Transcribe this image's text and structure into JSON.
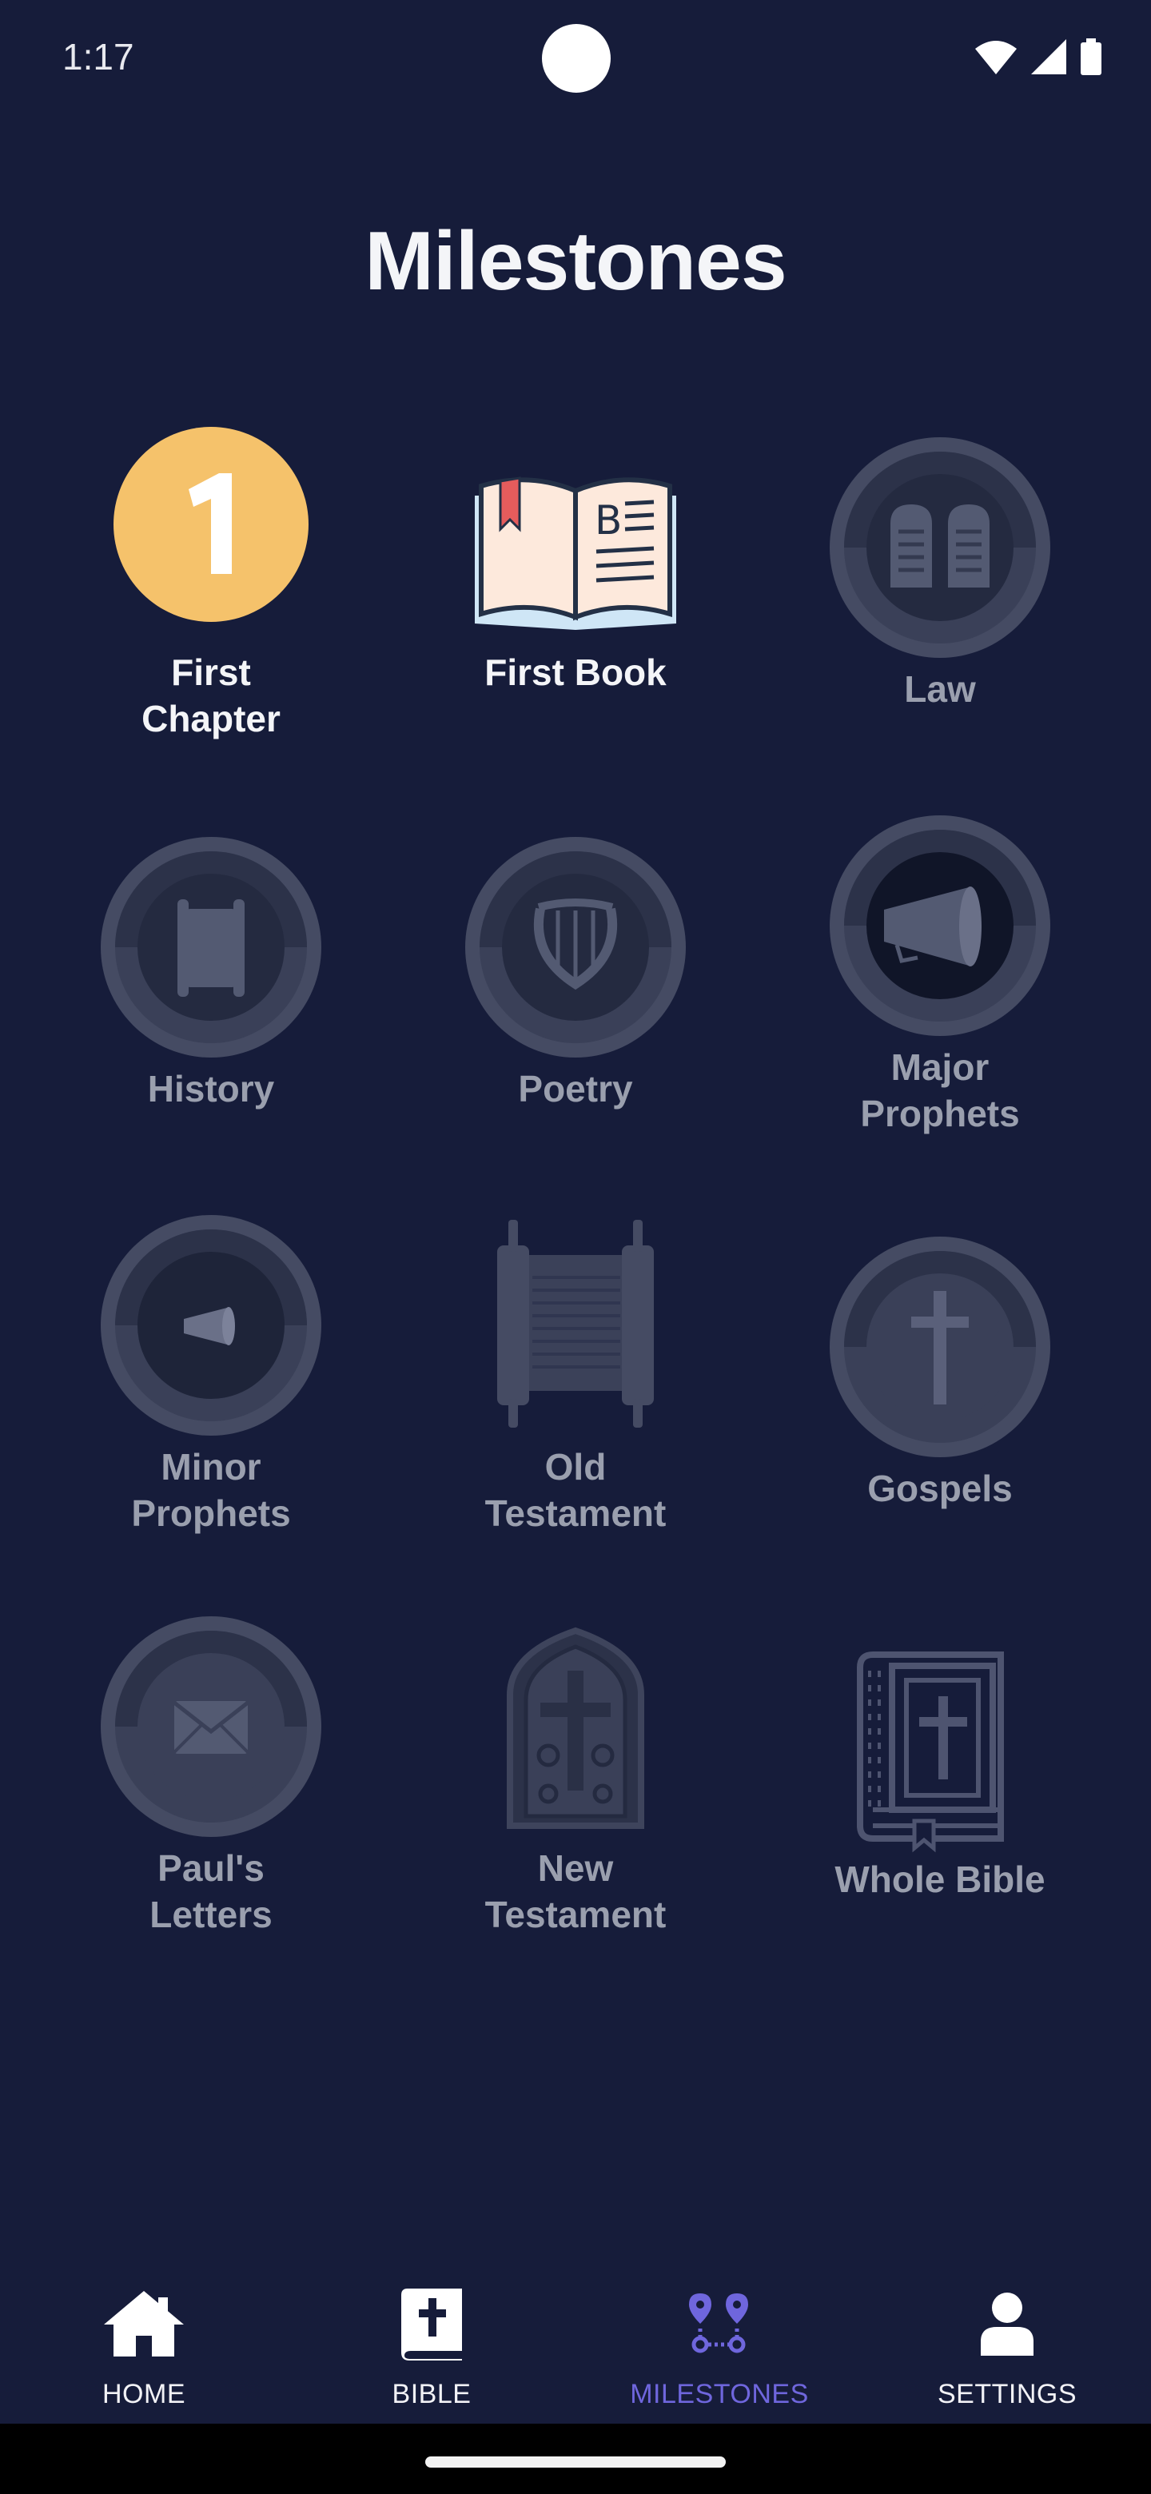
{
  "status_bar": {
    "time": "1:17",
    "icons": [
      "wifi-icon",
      "cell-signal-icon",
      "battery-icon"
    ]
  },
  "page": {
    "title": "Milestones"
  },
  "milestones": [
    {
      "label": "First\nChapter",
      "icon": "number-one-badge",
      "achieved": true
    },
    {
      "label": "First Book",
      "icon": "open-book-icon",
      "achieved": true
    },
    {
      "label": "Law",
      "icon": "stone-tablets-icon",
      "achieved": false
    },
    {
      "label": "History",
      "icon": "scroll-icon",
      "achieved": false
    },
    {
      "label": "Poetry",
      "icon": "lyre-icon",
      "achieved": false
    },
    {
      "label": "Major\nProphets",
      "icon": "megaphone-icon",
      "achieved": false
    },
    {
      "label": "Minor\nProphets",
      "icon": "small-megaphone-icon",
      "achieved": false
    },
    {
      "label": "Old\nTestament",
      "icon": "torah-scroll-icon",
      "achieved": false
    },
    {
      "label": "Gospels",
      "icon": "cross-icon",
      "achieved": false
    },
    {
      "label": "Paul's\nLetters",
      "icon": "envelope-icon",
      "achieved": false
    },
    {
      "label": "New\nTestament",
      "icon": "stained-glass-window-icon",
      "achieved": false
    },
    {
      "label": "Whole Bible",
      "icon": "bible-book-icon",
      "achieved": false
    }
  ],
  "nav": {
    "items": [
      {
        "label": "HOME",
        "icon": "home-icon"
      },
      {
        "label": "BIBLE",
        "icon": "bible-icon"
      },
      {
        "label": "MILESTONES",
        "icon": "route-pins-icon",
        "active": true
      },
      {
        "label": "SETTINGS",
        "icon": "person-icon"
      }
    ]
  },
  "colors": {
    "background": "#161c3a",
    "badge_gold": "#f5c26b",
    "locked_gray": "#4a5068",
    "active_nav": "#6f66dd"
  }
}
